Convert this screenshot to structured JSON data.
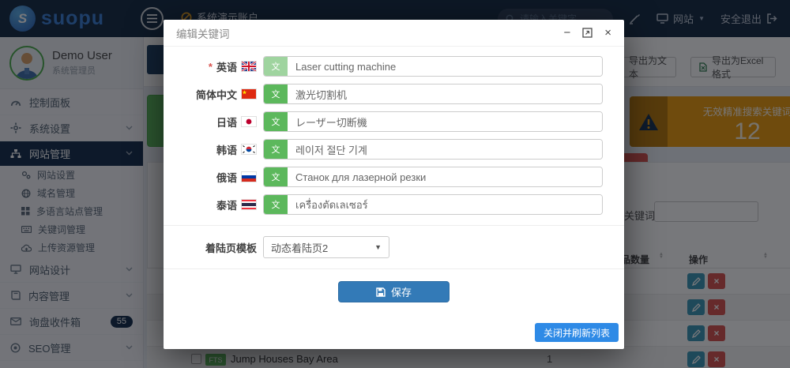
{
  "brand": {
    "name": "suopu"
  },
  "topbar": {
    "demo_account_label": "系统演示账户",
    "search_placeholder": "请输入关键字",
    "site_menu_label": "网站",
    "logout_label": "安全退出"
  },
  "user": {
    "name": "Demo User",
    "role": "系统管理员"
  },
  "sidebar": {
    "items": [
      {
        "label": "控制面板"
      },
      {
        "label": "系统设置"
      },
      {
        "label": "网站管理"
      },
      {
        "label": "网站设计"
      },
      {
        "label": "内容管理"
      },
      {
        "label": "询盘收件箱",
        "badge": "55"
      },
      {
        "label": "SEO管理"
      }
    ],
    "submenu": [
      {
        "label": "网站设置"
      },
      {
        "label": "域名管理"
      },
      {
        "label": "多语言站点管理"
      },
      {
        "label": "关键词管理"
      },
      {
        "label": "上传资源管理"
      }
    ]
  },
  "content": {
    "export_text_label": "导出为文本",
    "export_excel_label": "导出为Excel格式",
    "warning_card": {
      "title": "无效精准搜索关键词",
      "value": "12"
    },
    "filter_label": "关键词",
    "table": {
      "col_count": "产品数量",
      "col_actions": "操作",
      "row": {
        "badge": "FTS",
        "keyword": "Jump Houses Bay Area",
        "count": "1"
      }
    }
  },
  "modal": {
    "title": "编辑关键词",
    "required_mark": "*",
    "fields": [
      {
        "label": "英语",
        "value": "Laser cutting machine"
      },
      {
        "label": "简体中文",
        "value": "激光切割机"
      },
      {
        "label": "日语",
        "value": "レーザー切断機"
      },
      {
        "label": "韩语",
        "value": "레이저 절단 기계"
      },
      {
        "label": "俄语",
        "value": "Станок для лазерной резки"
      },
      {
        "label": "泰语",
        "value": "เครื่องตัดเลเซอร์"
      }
    ],
    "template_label": "着陆页模板",
    "template_value": "动态着陆页2",
    "save_label": "保存",
    "close_refresh_label": "关闭并刷新列表"
  },
  "colors": {
    "topbar_navy": "#152a44",
    "active_menu_navy": "#142e4d",
    "success_green": "#5cb85c",
    "warning_orange": "#ee9c0d",
    "danger_red": "#d9534f",
    "primary_blue": "#337ab7",
    "flat_blue": "#2e8ae6"
  }
}
